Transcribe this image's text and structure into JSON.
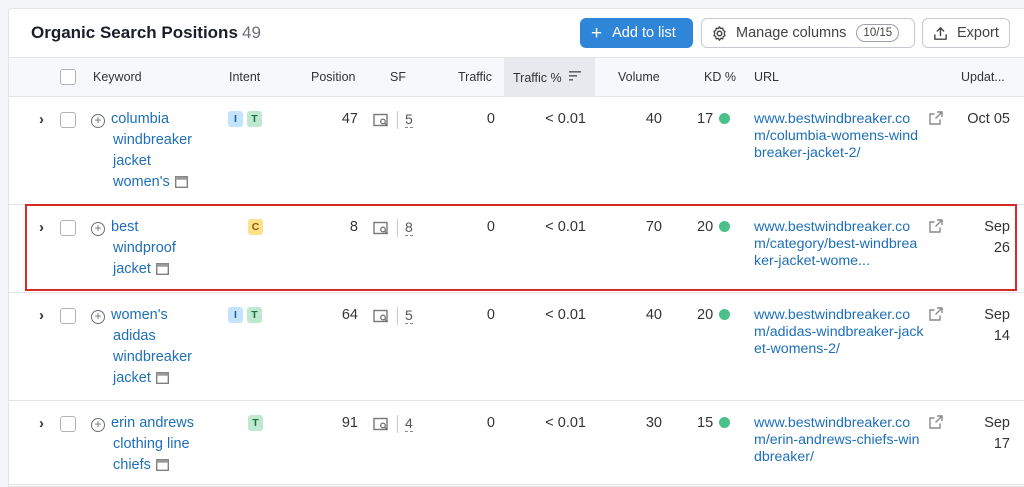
{
  "header": {
    "title": "Organic Search Positions",
    "count": "49",
    "add_button": "Add to list",
    "manage_button": "Manage columns",
    "manage_badge": "10/15",
    "export_button": "Export"
  },
  "columns": {
    "keyword": "Keyword",
    "intent": "Intent",
    "position": "Position",
    "sf": "SF",
    "traffic": "Traffic",
    "traffic_pct": "Traffic %",
    "volume": "Volume",
    "kd": "KD %",
    "url": "URL",
    "updated": "Updat..."
  },
  "rows": [
    {
      "keyword_lines": [
        "columbia",
        "windbreaker",
        "jacket",
        "women's"
      ],
      "intent": [
        "I",
        "T"
      ],
      "position": "47",
      "sf_count": "5",
      "traffic": "0",
      "traffic_pct": "< 0.01",
      "volume": "40",
      "kd": "17",
      "url": "www.bestwindbreaker.com/columbia-womens-windbreaker-jacket-2/",
      "updated_lines": [
        "Oct 05"
      ]
    },
    {
      "keyword_lines": [
        "best",
        "windproof",
        "jacket"
      ],
      "intent": [
        "C"
      ],
      "position": "8",
      "sf_count": "8",
      "traffic": "0",
      "traffic_pct": "< 0.01",
      "volume": "70",
      "kd": "20",
      "url": "www.bestwindbreaker.com/category/best-windbreaker-jacket-wome...",
      "updated_lines": [
        "Sep",
        "26"
      ]
    },
    {
      "keyword_lines": [
        "women's",
        "adidas",
        "windbreaker",
        "jacket"
      ],
      "intent": [
        "I",
        "T"
      ],
      "position": "64",
      "sf_count": "5",
      "traffic": "0",
      "traffic_pct": "< 0.01",
      "volume": "40",
      "kd": "20",
      "url": "www.bestwindbreaker.com/adidas-windbreaker-jacket-womens-2/",
      "updated_lines": [
        "Sep",
        "14"
      ]
    },
    {
      "keyword_lines": [
        "erin andrews",
        "clothing line",
        "chiefs"
      ],
      "intent": [
        "T"
      ],
      "position": "91",
      "sf_count": "4",
      "traffic": "0",
      "traffic_pct": "< 0.01",
      "volume": "30",
      "kd": "15",
      "url": "www.bestwindbreaker.com/erin-andrews-chiefs-windbreaker/",
      "updated_lines": [
        "Sep",
        "17"
      ]
    }
  ],
  "colors": {
    "primary": "#2f86d8",
    "link": "#1e6fb8",
    "kd_easy": "#4cc08a",
    "highlight": "#d42a2a"
  },
  "icons": {
    "add": "plus-icon",
    "manage": "gear-icon",
    "export": "export-icon",
    "expand": "chevron-right-icon",
    "add_keyword": "circle-plus-icon",
    "serp": "serp-preview-icon",
    "sf": "serp-features-icon",
    "external": "external-link-icon",
    "sort": "sort-icon"
  }
}
